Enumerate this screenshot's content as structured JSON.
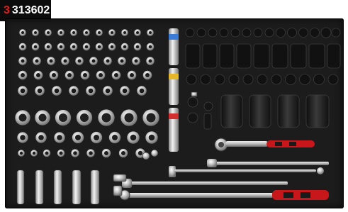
{
  "product": {
    "number_prefix": "3",
    "number_rest": "313602"
  }
}
